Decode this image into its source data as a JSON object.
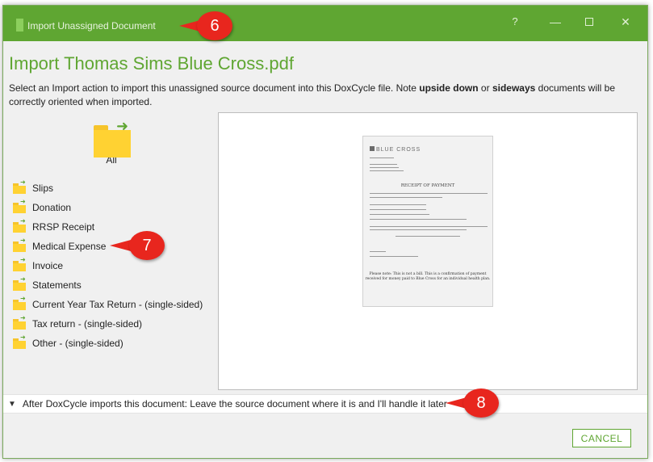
{
  "window": {
    "title": "Import Unassigned Document",
    "help_symbol": "?",
    "minimize_symbol": "—",
    "close_symbol": "✕"
  },
  "heading": "Import Thomas Sims Blue Cross.pdf",
  "description": {
    "part1": "Select an Import action to import this unassigned source document into this DoxCycle file. Note ",
    "bold1": "upside down",
    "part2": " or ",
    "bold2": "sideways",
    "part3": "  documents will be correctly oriented when imported."
  },
  "all_folder": {
    "label": "All",
    "icon": "folder-import-icon"
  },
  "folders": [
    {
      "label": "Slips"
    },
    {
      "label": "Donation"
    },
    {
      "label": "RRSP Receipt"
    },
    {
      "label": "Medical Expense"
    },
    {
      "label": "Invoice"
    },
    {
      "label": "Statements"
    },
    {
      "label": "Current Year Tax Return  -  (single-sided)"
    },
    {
      "label": "Tax return  -  (single-sided)"
    },
    {
      "label": "Other  -  (single-sided)"
    }
  ],
  "preview": {
    "logo_text": "BLUE CROSS",
    "doc_heading": "RECEIPT OF PAYMENT",
    "footer_note": "Please note: This is not a bill. This is a confirmation of payment received for money paid to Blue Cross for an individual health plan."
  },
  "after_import": {
    "text": "After DoxCycle imports this document: Leave the source document where it is and I'll handle it later"
  },
  "cancel_label": "CANCEL",
  "callouts": {
    "six": "6",
    "seven": "7",
    "eight": "8"
  },
  "colors": {
    "brand_green": "#5fa632",
    "folder_yellow": "#ffd232",
    "callout_red": "#e8261e"
  }
}
